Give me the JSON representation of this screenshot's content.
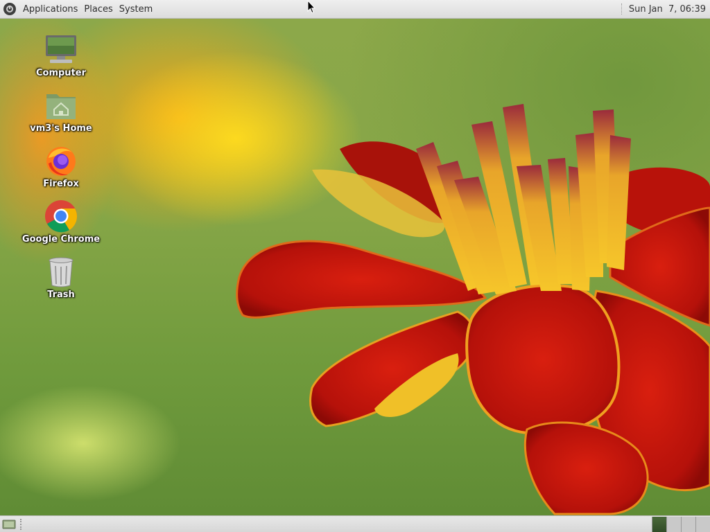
{
  "top_panel": {
    "menus": [
      "Applications",
      "Places",
      "System"
    ],
    "clock": "Sun Jan  7, 06:39"
  },
  "desktop_icons": [
    {
      "label": "Computer",
      "icon": "computer-icon"
    },
    {
      "label": "vm3's Home",
      "icon": "home-folder-icon"
    },
    {
      "label": "Firefox",
      "icon": "firefox-icon"
    },
    {
      "label": "Google Chrome",
      "icon": "chrome-icon"
    },
    {
      "label": "Trash",
      "icon": "trash-icon"
    }
  ],
  "bottom_panel": {
    "workspaces": 4,
    "active_workspace": 1
  },
  "colors": {
    "panel": "#dcdcdc",
    "petal_red": "#c4160d",
    "petal_yellow": "#f2c21a"
  }
}
